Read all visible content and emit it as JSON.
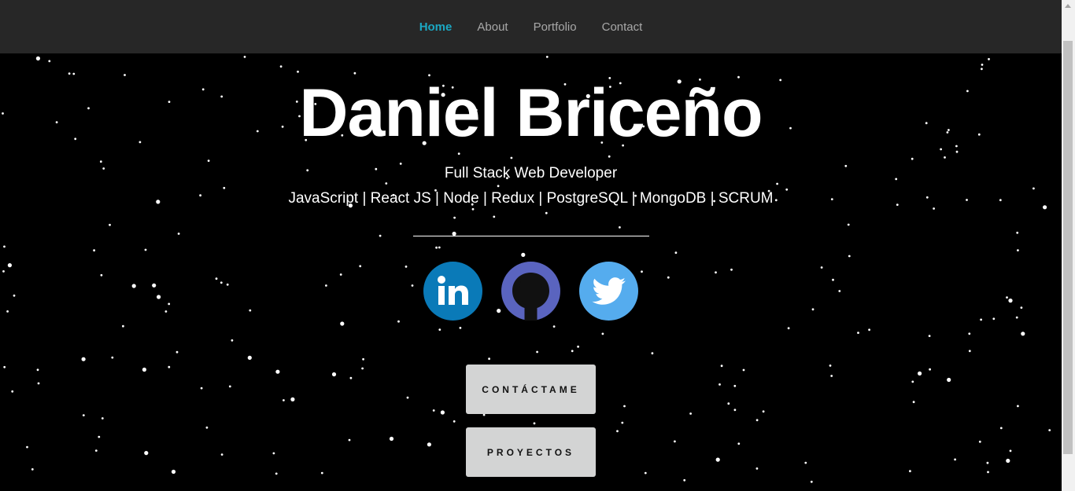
{
  "nav": {
    "items": [
      {
        "label": "Home",
        "active": true
      },
      {
        "label": "About",
        "active": false
      },
      {
        "label": "Portfolio",
        "active": false
      },
      {
        "label": "Contact",
        "active": false
      }
    ]
  },
  "hero": {
    "name": "Daniel Briceño",
    "role": "Full Stack Web Developer",
    "stack": "JavaScript | React JS | Node | Redux | PostgreSQL | MongoDB | SCRUM"
  },
  "socials": [
    {
      "icon": "linkedin-icon",
      "color": "#0a7ab8"
    },
    {
      "icon": "github-icon",
      "color": "#5a64bf"
    },
    {
      "icon": "twitter-icon",
      "color": "#55acee"
    }
  ],
  "buttons": {
    "contact_label": "CONTÁCTAME",
    "projects_label": "PROYECTOS"
  },
  "colors": {
    "accent": "#1ba7c2",
    "navbar_bg": "#272727",
    "background": "#000000",
    "button_bg": "#d3d4d4"
  }
}
